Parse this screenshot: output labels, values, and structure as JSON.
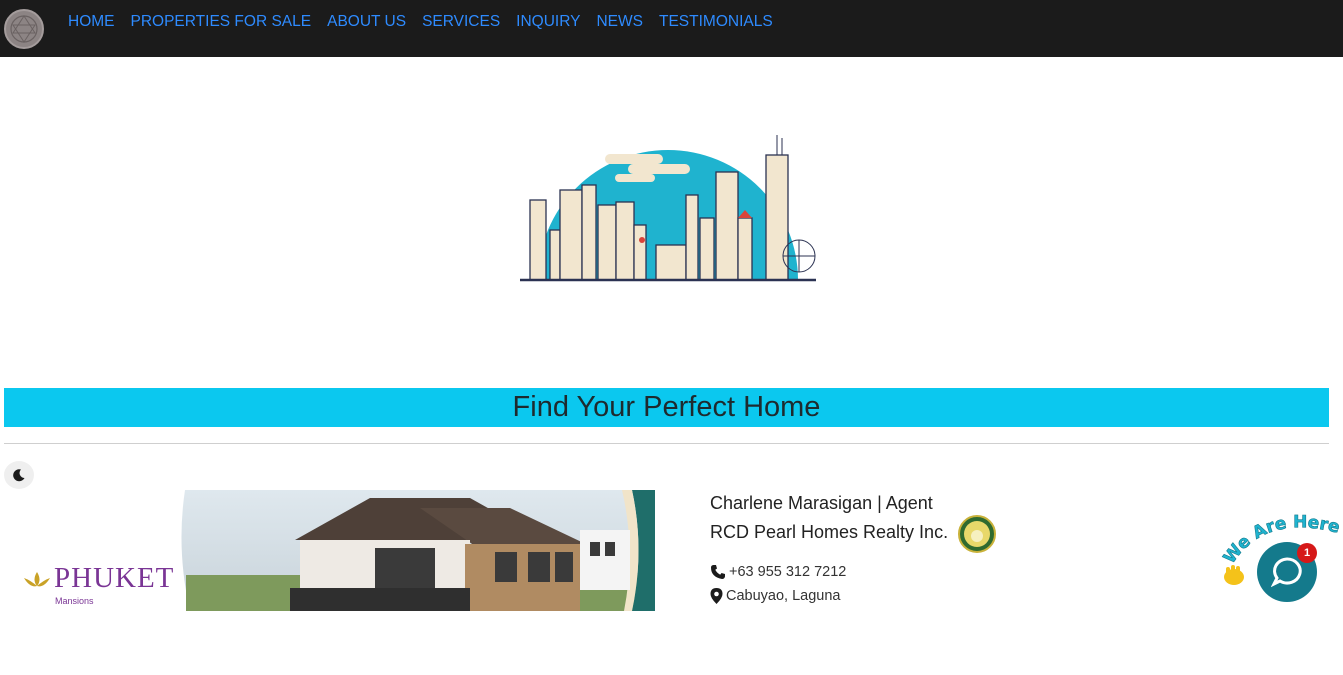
{
  "nav": {
    "items": [
      {
        "label": "HOME"
      },
      {
        "label": "PROPERTIES FOR SALE"
      },
      {
        "label": "ABOUT US"
      },
      {
        "label": "SERVICES"
      },
      {
        "label": "INQUIRY"
      },
      {
        "label": "NEWS"
      },
      {
        "label": "TESTIMONIALS"
      }
    ]
  },
  "banner": {
    "title": "Find Your Perfect Home"
  },
  "ad": {
    "brand": "PHUKET",
    "brand_sub": "Mansions"
  },
  "agent": {
    "name": "Charlene Marasigan | Agent",
    "company": "RCD Pearl Homes Realty Inc.",
    "phone": "+63 955 312 7212",
    "location": "Cabuyao, Laguna"
  },
  "chat": {
    "tagline": "We Are Here!",
    "unread_count": "1"
  },
  "colors": {
    "nav_bg": "#1b1b1b",
    "nav_link": "#2e8bff",
    "banner_bg": "#0bc8ef",
    "chat": "#147a8c"
  }
}
